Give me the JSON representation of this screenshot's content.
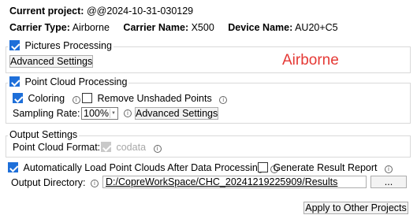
{
  "header": {
    "project_label": "Current project:",
    "project_value": "@@2024-10-31-030129",
    "carrier_type_label": "Carrier Type:",
    "carrier_type_value": "Airborne",
    "carrier_name_label": "Carrier Name:",
    "carrier_name_value": "X500",
    "device_name_label": "Device Name:",
    "device_name_value": "AU20+C5"
  },
  "pictures": {
    "title": "Pictures Processing",
    "checked": true,
    "advanced_button": "Advanced Settings",
    "watermark_text": "Airborne"
  },
  "point_cloud": {
    "title": "Point Cloud Processing",
    "checked": true,
    "coloring_label": "Coloring",
    "coloring_checked": true,
    "remove_unshaded_label": "Remove Unshaded Points",
    "remove_unshaded_checked": false,
    "sampling_rate_label": "Sampling Rate:",
    "sampling_rate_value": "100%",
    "advanced_button": "Advanced Settings"
  },
  "output_settings": {
    "title": "Output Settings",
    "format_label": "Point Cloud Format:",
    "format_value": "codata",
    "format_checked": true
  },
  "auto_load": {
    "label": "Automatically Load Point Clouds After Data Processing",
    "checked": true,
    "generate_report_label": "Generate Result Report",
    "generate_report_checked": false
  },
  "output_directory": {
    "label": "Output Directory:",
    "value": "D:/CopreWorkSpace/CHC_20241219225909/Results",
    "browse_button": "..."
  },
  "footer": {
    "apply_button": "Apply to Other Projects"
  },
  "icons": {
    "info": "info-icon",
    "checkbox": "checkbox-icon",
    "dropdown": "chevron-down-icon"
  },
  "colors": {
    "accent": "#1e6fd9",
    "watermark": "#e53935",
    "disabled": "#a8a8a8"
  }
}
